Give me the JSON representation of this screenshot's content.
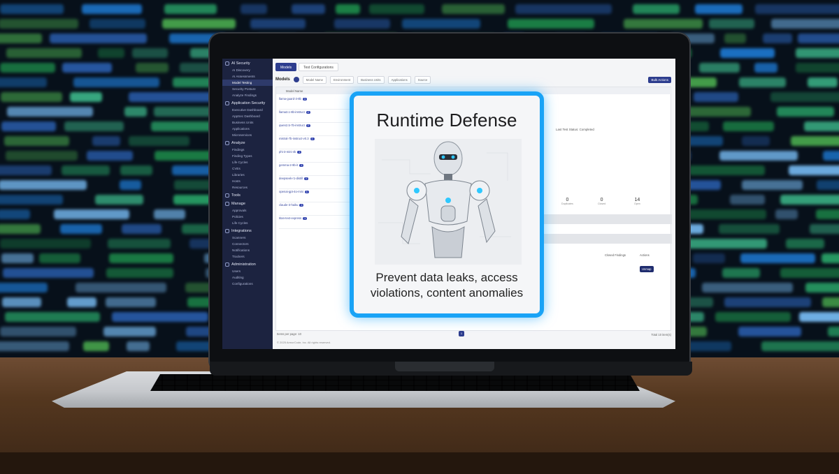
{
  "app": {
    "tabs": [
      "Models",
      "Test Configurations"
    ],
    "toolbar": {
      "title": "Models",
      "search_placeholder": "Model Name",
      "filters": [
        "Environment",
        "Business Units",
        "Applications",
        "Source"
      ],
      "bulk_label": "Bulk Actions"
    },
    "sidebar": {
      "sections": [
        {
          "label": "AI Security",
          "items": [
            "AI Discovery",
            "AI Assessments",
            "Model Testing",
            "Security Posture",
            "Analyze Findings"
          ]
        },
        {
          "label": "Application Security",
          "items": [
            "Executive Dashboard",
            "AppSec Dashboard",
            "Business Units",
            "Applications",
            "Microservices"
          ]
        },
        {
          "label": "Analyze",
          "items": [
            "Findings",
            "Finding Types",
            "Life Cycles",
            "CVEs",
            "Libraries",
            "Hosts",
            "Resources"
          ]
        },
        {
          "label": "Tools",
          "items": []
        },
        {
          "label": "Manage",
          "items": [
            "Approvals",
            "Policies",
            "Life Cycles"
          ]
        },
        {
          "label": "Integrations",
          "items": [
            "Scanners",
            "Connectors",
            "Notifications",
            "Trackers"
          ]
        },
        {
          "label": "Administration",
          "items": [
            "Users",
            "Auditing",
            "Configurations"
          ]
        }
      ],
      "active_item": "Model Testing"
    },
    "table": {
      "column_header": "Model Name",
      "rows": [
        {
          "name": "llama-guard-3-8b",
          "count": "3"
        },
        {
          "name": "llama3.1-8b-instruct",
          "count": "2"
        },
        {
          "name": "qwen2.5-7b-instruct",
          "count": "2"
        },
        {
          "name": "mistral-7b-instruct-v0.3",
          "count": "1"
        },
        {
          "name": "phi-3-mini-4k",
          "count": "1"
        },
        {
          "name": "gemma-2-9b-it",
          "count": "1"
        },
        {
          "name": "deepseek-r1-distill",
          "count": "1"
        },
        {
          "name": "openai-gpt-4o-mini",
          "count": "1"
        },
        {
          "name": "claude-3-haiku",
          "count": "1"
        },
        {
          "name": "titan-text-express",
          "count": "1"
        }
      ],
      "last_test_status": "Last Test Status:",
      "last_test_value": "Completed",
      "stats": [
        {
          "value": "0",
          "label": "Duplicates"
        },
        {
          "value": "0",
          "label": "Closed"
        },
        {
          "value": "14",
          "label": "Open"
        }
      ],
      "closed_findings_label": "Closed Findings",
      "actions_label": "Actions",
      "unmap_label": "Unmap"
    },
    "footer": {
      "items_per_page": "Items per page:",
      "items_per_page_value": "10",
      "page": "1",
      "total": "Total 10 item(s)",
      "copyright": "© 2025 ArmorCode, Inc. All rights reserved."
    }
  },
  "card": {
    "title": "Runtime Defense",
    "subtitle": "Prevent data leaks, access violations, content anomalies"
  },
  "colors": {
    "card_border": "#19a3f6",
    "sidebar": "#1c2340",
    "accent": "#2d3d8e"
  }
}
